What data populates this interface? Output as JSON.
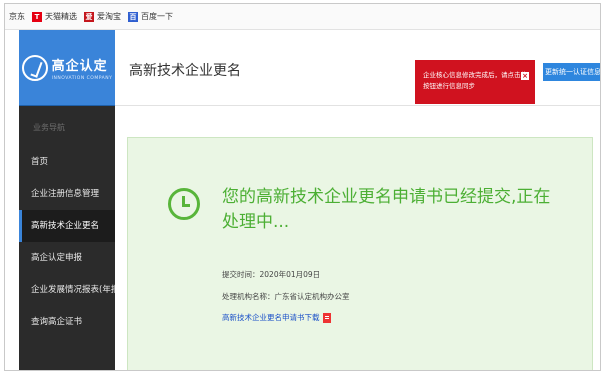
{
  "bookmarks": [
    {
      "label": "京东",
      "icon": ""
    },
    {
      "label": "天猫精选",
      "icon": "T"
    },
    {
      "label": "爱淘宝",
      "icon": "爱"
    },
    {
      "label": "百度一下",
      "icon": "百"
    }
  ],
  "sidebar": {
    "logo_cn": "高企认定",
    "logo_en": "INNOVATION COMPANY",
    "nav_title": "业务导航",
    "items": [
      {
        "label": "首页"
      },
      {
        "label": "企业注册信息管理"
      },
      {
        "label": "高新技术企业更名"
      },
      {
        "label": "高企认定申报"
      },
      {
        "label": "企业发展情况报表(年报)"
      },
      {
        "label": "查询高企证书"
      }
    ]
  },
  "header": {
    "title": "高新技术企业更名",
    "alert_text": "企业核心信息修改完成后，请点击此按钮进行信息同步",
    "verify_button": "更新统一认证信息"
  },
  "status": {
    "message": "您的高新技术企业更名申请书已经提交,正在处理中...",
    "submit_time": "提交时间：2020年01月09日",
    "org": "处理机构名称：广东省认定机构办公室",
    "download_link": "高新技术企业更名申请书下载"
  },
  "colors": {
    "sidebar_bg": "#2b2b2b",
    "logo_bg": "#3a84d9",
    "alert_red": "#d0121f",
    "success_green": "#4caf34",
    "panel_bg": "#eaf6e4",
    "link_blue": "#1a50c8"
  }
}
